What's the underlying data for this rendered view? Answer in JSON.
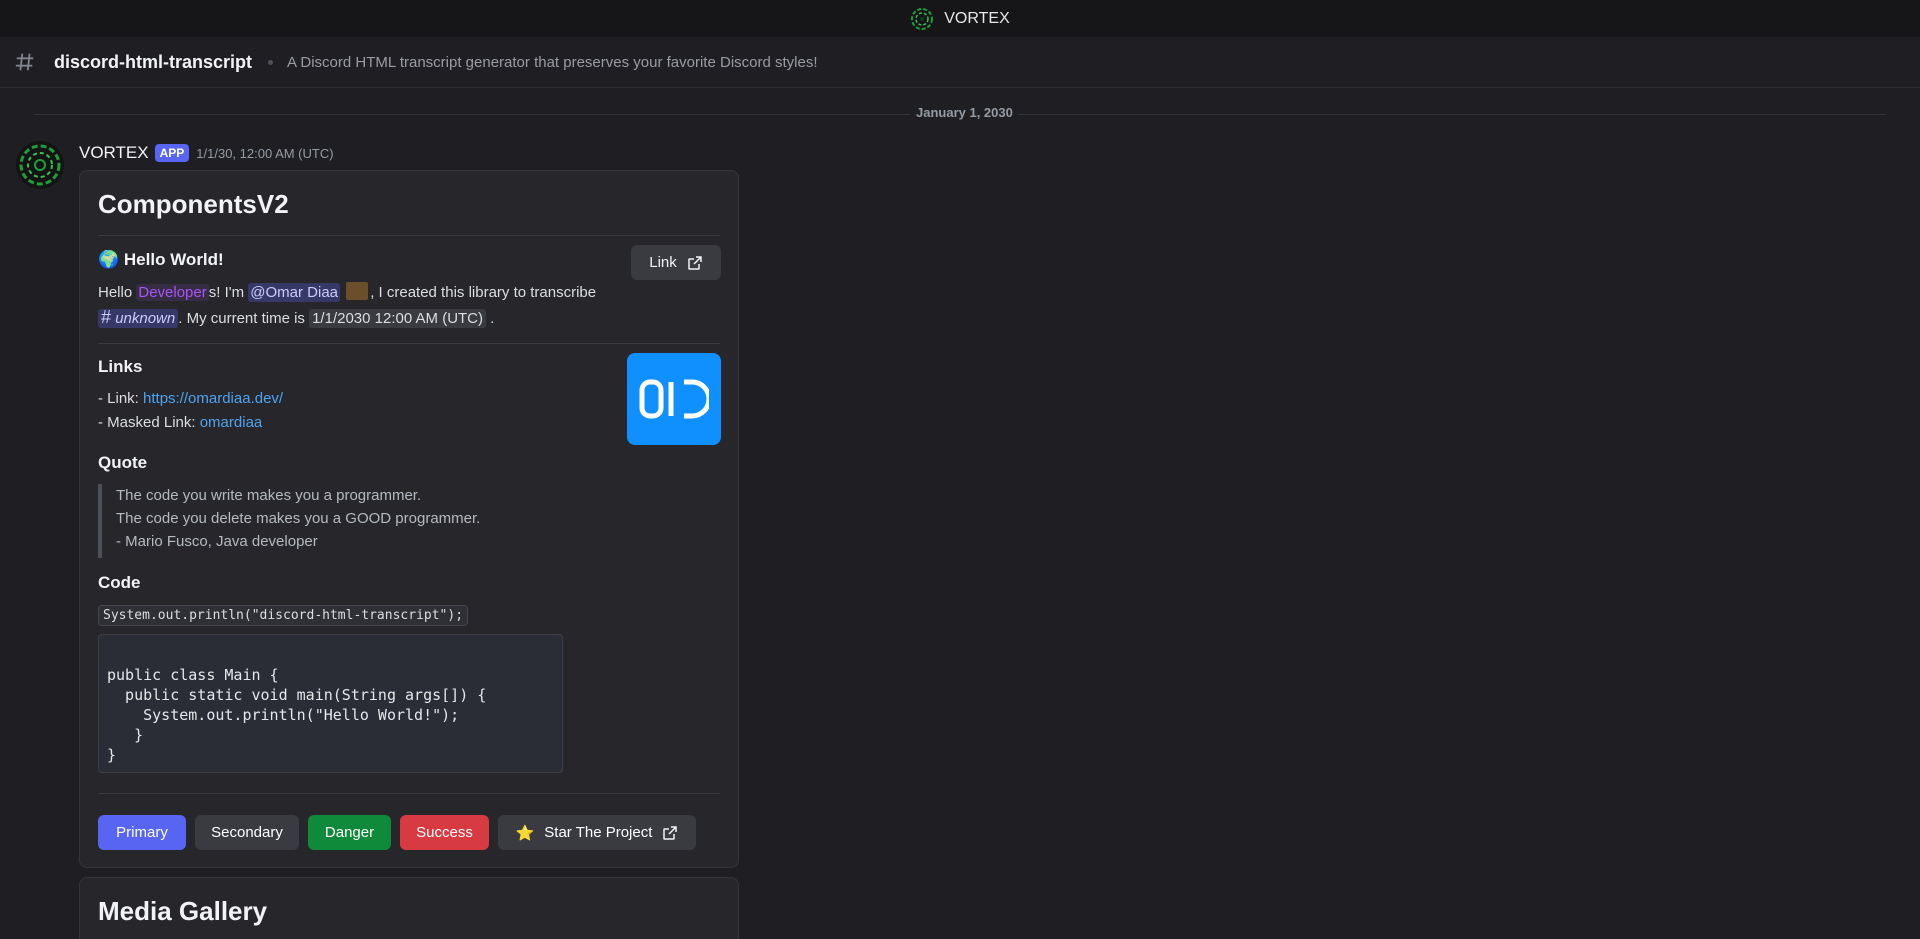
{
  "window": {
    "title": "VORTEX"
  },
  "channel": {
    "name": "discord-html-transcript",
    "topic": "A Discord HTML transcript generator that preserves your favorite Discord styles!"
  },
  "date_divider": "January 1, 2030",
  "message": {
    "author": "VORTEX",
    "badge": "APP",
    "timestamp": "1/1/30, 12:00 AM (UTC)"
  },
  "container": {
    "title": "ComponentsV2",
    "hello": {
      "emoji": "🌍",
      "heading": "Hello World!",
      "t1": "Hello ",
      "role_mention": "Developer",
      "t2": "s! I'm ",
      "user_mention": "@Omar Diaa",
      "t3": ", I created this library to transcribe",
      "channel_mention": "unknown",
      "t4": ". My current time is ",
      "time_chip": "1/1/2030 12:00 AM (UTC)",
      "t5": " .",
      "link_button": "Link"
    },
    "links": {
      "heading": "Links",
      "link_prefix": "- Link: ",
      "link_url": "https://omardiaa.dev/",
      "masked_prefix": "- Masked Link: ",
      "masked_text": "omardiaa"
    },
    "quote": {
      "heading": "Quote",
      "lines": [
        "The code you write makes you a programmer.",
        "The code you delete makes you a GOOD programmer.",
        "- Mario Fusco, Java developer"
      ]
    },
    "code": {
      "heading": "Code",
      "inline": "System.out.println(\"discord-html-transcript\");",
      "block": "public class Main {\n  public static void main(String args[]) {\n    System.out.println(\"Hello World!\");\n   }\n}"
    },
    "buttons": {
      "primary": "Primary",
      "secondary": "Secondary",
      "danger": "Danger",
      "success": "Success",
      "star": "Star The Project",
      "star_emoji": "⭐"
    }
  },
  "gallery": {
    "title": "Media Gallery"
  },
  "colors": {
    "primary": "#5865f2",
    "danger": "#0f8a3a",
    "success": "#d83a42",
    "link": "#4ea3f0",
    "role": "#a855f7"
  }
}
